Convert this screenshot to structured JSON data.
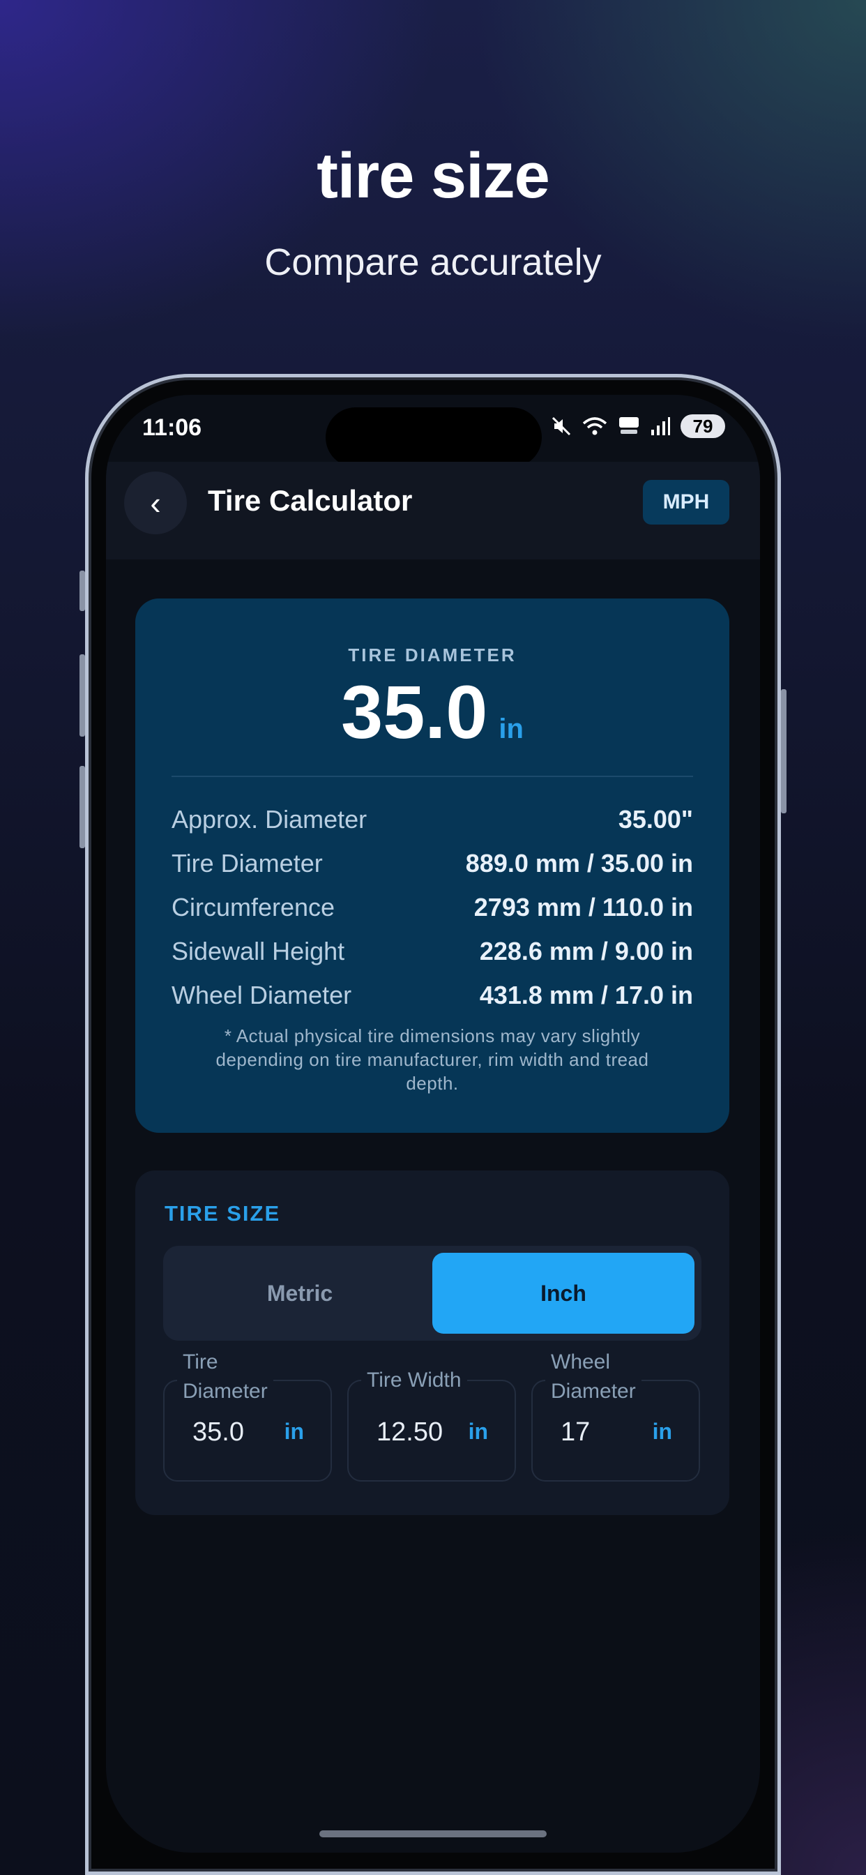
{
  "promo": {
    "headline": "tire size",
    "subline": "Compare accurately"
  },
  "status_bar": {
    "time": "11:06",
    "battery": "79",
    "icons": [
      "mute-icon",
      "wifi-icon",
      "hd-voice-icon",
      "signal-icon",
      "battery-icon"
    ]
  },
  "app_bar": {
    "back_glyph": "‹",
    "title": "Tire Calculator",
    "unit_button": "MPH"
  },
  "result": {
    "label": "TIRE DIAMETER",
    "value": "35.0",
    "unit": "in",
    "rows": [
      {
        "key": "Approx. Diameter",
        "value": "35.00\""
      },
      {
        "key": "Tire Diameter",
        "value": "889.0 mm / 35.00 in"
      },
      {
        "key": "Circumference",
        "value": "2793 mm / 110.0 in"
      },
      {
        "key": "Sidewall Height",
        "value": "228.6 mm / 9.00 in"
      },
      {
        "key": "Wheel Diameter",
        "value": "431.8 mm / 17.0 in"
      }
    ],
    "note": "* Actual physical tire dimensions may vary slightly depending on tire manufacturer, rim width and tread depth."
  },
  "tire_size": {
    "title": "TIRE SIZE",
    "toggle": {
      "options": [
        "Metric",
        "Inch"
      ],
      "selected": "Inch"
    },
    "fields": [
      {
        "label": "Tire\nDiameter",
        "value": "35.0",
        "unit": "in"
      },
      {
        "label": "Tire Width",
        "value": "12.50",
        "unit": "in"
      },
      {
        "label": "Wheel\nDiameter",
        "value": "17",
        "unit": "in"
      }
    ]
  },
  "colors": {
    "accent": "#22a6f5",
    "result_card": "#063656",
    "screen_bg": "#0b0f17"
  }
}
